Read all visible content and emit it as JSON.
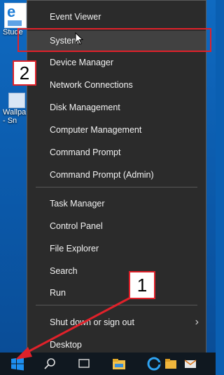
{
  "desktop": {
    "icons": [
      {
        "label": "Stude",
        "icon": "edge-document-icon"
      },
      {
        "label": "Wallpa\n- Sn",
        "icon": "wallpaper-shortcut-icon"
      }
    ]
  },
  "menu": {
    "items": [
      {
        "label": "Event Viewer"
      },
      {
        "label": "System"
      },
      {
        "label": "Device Manager"
      },
      {
        "label": "Network Connections"
      },
      {
        "label": "Disk Management"
      },
      {
        "label": "Computer Management"
      },
      {
        "label": "Command Prompt"
      },
      {
        "label": "Command Prompt (Admin)"
      },
      {
        "label": "Task Manager"
      },
      {
        "label": "Control Panel"
      },
      {
        "label": "File Explorer"
      },
      {
        "label": "Search"
      },
      {
        "label": "Run"
      },
      {
        "label": "Shut down or sign out"
      },
      {
        "label": "Desktop"
      }
    ],
    "hovered": "System"
  },
  "annotations": {
    "step1": "1",
    "step2": "2",
    "highlight_color": "#e0212a"
  },
  "taskbar": {
    "icons": [
      "windows-start-icon",
      "search-icon",
      "task-view-icon",
      "file-explorer-icon",
      "edge-browser-icon",
      "folder-icon",
      "mail-icon"
    ]
  }
}
